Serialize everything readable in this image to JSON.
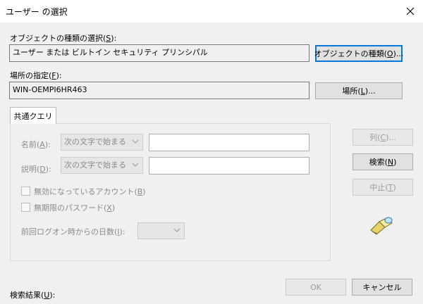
{
  "window": {
    "title": "ユーザー の選択",
    "close_icon": "close-icon"
  },
  "object_type": {
    "label": "オブジェクトの種類の選択(",
    "label_key": "S",
    "label_end": "):",
    "value": "ユーザー または ビルトイン セキュリティ プリンシパル",
    "button": "オブジェクトの種類(",
    "button_key": "O",
    "button_end": ")..."
  },
  "location": {
    "label": "場所の指定(",
    "label_key": "F",
    "label_end": "):",
    "value": "WIN-OEMPI6HR463",
    "button": "場所(",
    "button_key": "L",
    "button_end": ")..."
  },
  "tab": {
    "label": "共通クエリ"
  },
  "query": {
    "name_label": "名前(",
    "name_key": "A",
    "name_end": "):",
    "name_combo": "次の文字で始まる",
    "desc_label": "説明(",
    "desc_key": "D",
    "desc_end": "):",
    "desc_combo": "次の文字で始まる",
    "disabled_label": "無効になっているアカウント(",
    "disabled_key": "B",
    "disabled_end": ")",
    "noexpire_label": "無期限のパスワード(",
    "noexpire_key": "X",
    "noexpire_end": ")",
    "days_label": "前回ログオン時からの日数(",
    "days_key": "I",
    "days_end": "):"
  },
  "side_buttons": {
    "columns": "列(",
    "columns_key": "C",
    "columns_end": ")...",
    "search": "検索(",
    "search_key": "N",
    "search_end": ")",
    "stop": "中止(",
    "stop_key": "T",
    "stop_end": ")",
    "icon": "search-flashlight-icon"
  },
  "results": {
    "label": "検索結果(",
    "label_key": "U",
    "label_end": "):"
  },
  "footer": {
    "ok": "OK",
    "cancel": "キャンセル"
  }
}
